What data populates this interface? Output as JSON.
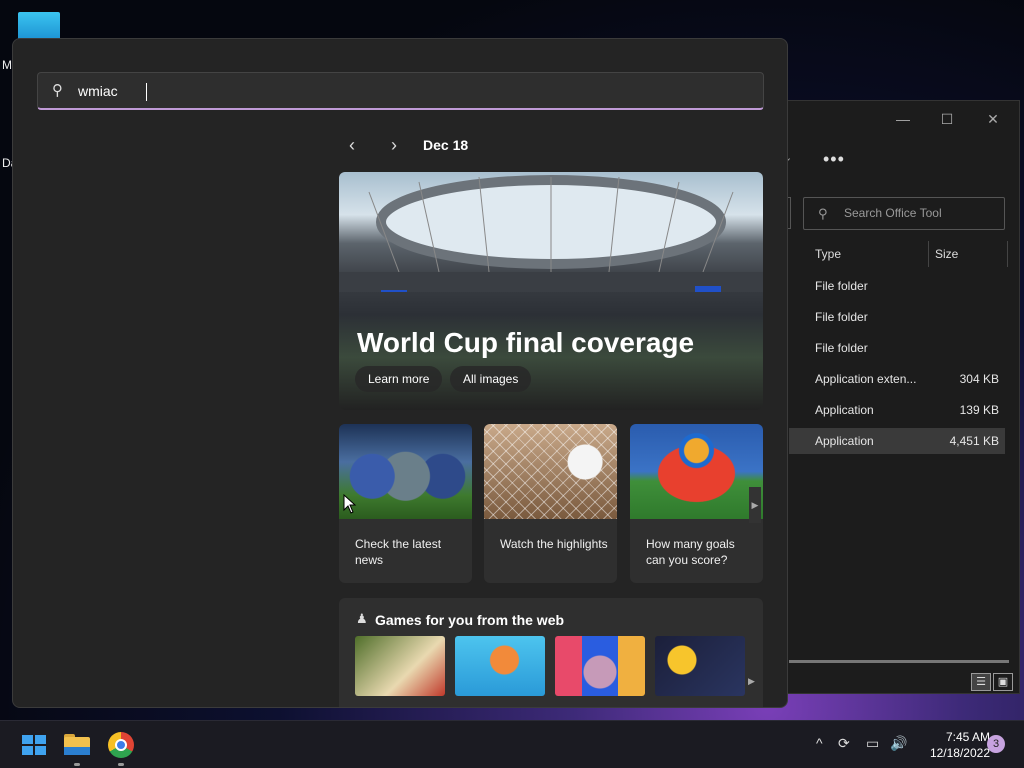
{
  "desktop": {
    "label_1": "M",
    "label_2": "Da"
  },
  "explorer": {
    "minimize": "—",
    "maximize": "☐",
    "close": "✕",
    "more": "•••",
    "chevron": "⌄",
    "search_placeholder": "Search Office Tool",
    "columns": {
      "type": "Type",
      "size": "Size"
    },
    "rows": [
      {
        "type": "File folder",
        "size": ""
      },
      {
        "type": "File folder",
        "size": ""
      },
      {
        "type": "File folder",
        "size": ""
      },
      {
        "type": "Application exten...",
        "size": "304 KB"
      },
      {
        "type": "Application",
        "size": "139 KB"
      },
      {
        "type": "Application",
        "size": "4,451 KB"
      }
    ]
  },
  "search": {
    "query": "wmiac",
    "icon": "search-icon"
  },
  "highlights": {
    "date": "Dec 18",
    "prev": "‹",
    "next": "›",
    "hero": {
      "title": "World Cup final coverage",
      "learn_more": "Learn more",
      "all_images": "All images"
    },
    "cards": [
      {
        "caption": "Check the latest news"
      },
      {
        "caption": "Watch the highlights"
      },
      {
        "caption": "How many goals can you score?"
      }
    ],
    "card_scroll": "▶",
    "games": {
      "title": "Games for you from the web",
      "scroll": "▶"
    }
  },
  "taskbar": {
    "clock_time": "7:45 AM",
    "clock_date": "12/18/2022",
    "notification_count": "3",
    "tray_up": "^",
    "tray_sync": "⟳",
    "tray_network": "▭",
    "tray_volume": "🔊"
  },
  "colors": {
    "accent": "#c09ad6",
    "flyout_bg": "#242424",
    "card_bg": "#2f2f2f"
  }
}
